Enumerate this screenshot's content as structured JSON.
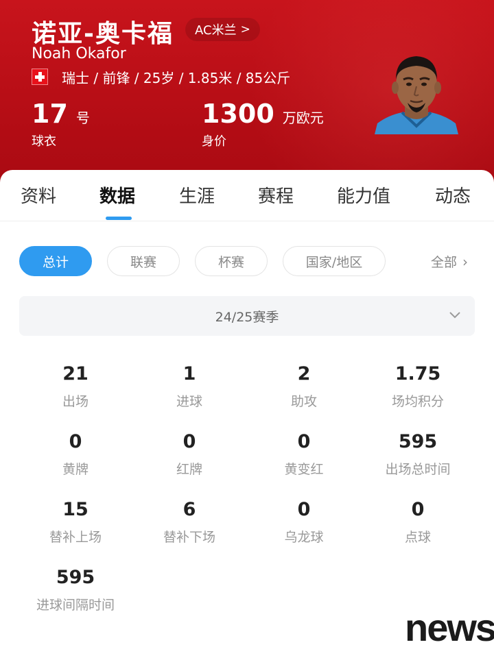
{
  "header": {
    "name_cn": "诺亚-奥卡福",
    "club": "AC米兰",
    "club_chevron": ">",
    "name_en": "Noah Okafor",
    "flag_icon": "switzerland-flag-icon",
    "info": "瑞士 / 前锋 / 25岁 / 1.85米 / 85公斤",
    "jersey": {
      "value": "17",
      "unit": "号",
      "caption": "球衣"
    },
    "market_value": {
      "value": "1300",
      "unit": "万欧元",
      "caption": "身价"
    },
    "brand_color": "#c8141c"
  },
  "tabs": [
    "资料",
    "数据",
    "生涯",
    "赛程",
    "能力值",
    "动态"
  ],
  "active_tab": "数据",
  "accent_color": "#2f9bf0",
  "filters": {
    "chips": [
      "总计",
      "联赛",
      "杯赛",
      "国家/地区"
    ],
    "active": "总计",
    "all_label": "全部",
    "all_chevron": "›"
  },
  "season": {
    "label": "24/25赛季",
    "icon": "chevron-down-icon"
  },
  "stats": [
    {
      "value": "21",
      "label": "出场"
    },
    {
      "value": "1",
      "label": "进球"
    },
    {
      "value": "2",
      "label": "助攻"
    },
    {
      "value": "1.75",
      "label": "场均积分"
    },
    {
      "value": "0",
      "label": "黄牌"
    },
    {
      "value": "0",
      "label": "红牌"
    },
    {
      "value": "0",
      "label": "黄变红"
    },
    {
      "value": "595",
      "label": "出场总时间"
    },
    {
      "value": "15",
      "label": "替补上场"
    },
    {
      "value": "6",
      "label": "替补下场"
    },
    {
      "value": "0",
      "label": "乌龙球"
    },
    {
      "value": "0",
      "label": "点球"
    },
    {
      "value": "595",
      "label": "进球间隔时间"
    }
  ],
  "watermark": "news"
}
